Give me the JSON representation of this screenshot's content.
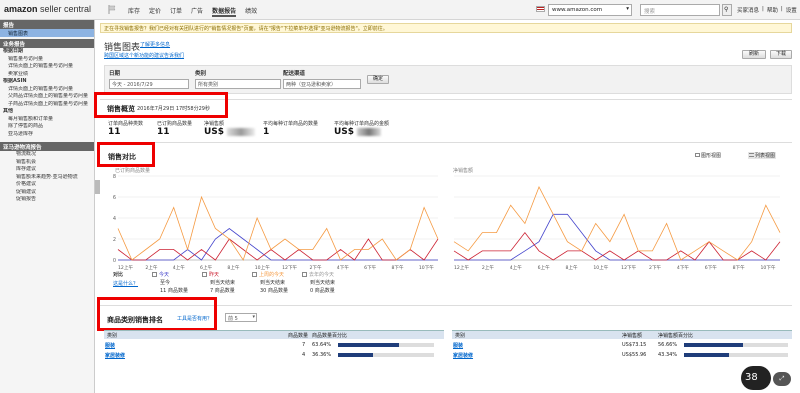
{
  "header": {
    "logo_text": "amazon",
    "logo_suffix": "seller central",
    "nav": [
      "库存",
      "定价",
      "订单",
      "广告",
      "数据报告",
      "绩效"
    ],
    "active_nav": 4,
    "site": "www.amazon.com",
    "search_placeholder": "搜索",
    "links": [
      "买家消息",
      "帮助",
      "设置"
    ]
  },
  "sidebar": {
    "head1": "报告",
    "selected": "销售图表",
    "head2": "业务报告",
    "groups": [
      {
        "title": "根据日期",
        "items": [
          "销售量与访问量",
          "详情页面上的销售量与访问量",
          "卖家业绩"
        ]
      },
      {
        "title": "根据ASIN",
        "items": [
          "详情页面上的销售量与访问量",
          "父商品详情页面上的销售量与访问量",
          "子商品详情页面上的销售量与访问量"
        ]
      },
      {
        "title": "其他",
        "items": [
          "每月销售额和订单量",
          "除了停售的商品",
          "亚马逊库存"
        ]
      }
    ],
    "head3": "亚马逊物流报告",
    "fba_items": [
      "物流概况",
      "销售机会",
      "库存建议",
      "销售额未来趋势·亚马逊物流",
      "价格建议",
      "促销建议",
      "促销报告"
    ]
  },
  "notice": "正在寻找销售报告？我们已经对有关团队进行的\"销售情况报告\"页面，请在\"报告\"下拉菜单中选择\"亚马逊物流报告\"。立即前往。",
  "page": {
    "title": "销售图表",
    "learn_more": "了解更多信息",
    "subtitle": "跨国区域这个新功能的建议告诉我们",
    "refresh": "刷新",
    "download": "下载"
  },
  "filters": {
    "date_label": "日期",
    "date_value": "今天 - 2016/7/29",
    "category_label": "类别",
    "category_value": "所有类别",
    "channel_label": "配送渠道",
    "channel_value": "两种（亚马逊和卖家）",
    "apply": "确定"
  },
  "snapshot": {
    "title": "销售概览",
    "timestamp": "2016年7月29日 17时58分29秒",
    "metrics": [
      {
        "label": "订单商品种类数",
        "value": "11"
      },
      {
        "label": "已订购商品数量",
        "value": "11"
      },
      {
        "label": "净销售额",
        "value": "US$"
      },
      {
        "label": "平均每种订单商品的数量",
        "value": "1"
      },
      {
        "label": "平均每种订单商品的金额",
        "value": "US$"
      }
    ]
  },
  "compare": {
    "title": "销售对比",
    "view_graph": "图形视图",
    "view_table": "列表视图",
    "left_title": "已订购商品数量",
    "right_title": "净销售额",
    "left_ylabels": [
      "8",
      "6",
      "4",
      "2",
      "0"
    ],
    "xlabels": [
      "12上午",
      "2上午",
      "4上午",
      "6上午",
      "8上午",
      "10上午",
      "12下午",
      "2下午",
      "4下午",
      "6下午",
      "8下午",
      "10下午"
    ],
    "legend_label": "对比",
    "legend_link": "这是什么？",
    "series": [
      {
        "name": "今天",
        "color": "#4444cc",
        "sub1": "至今",
        "sub2": "11 商品数量"
      },
      {
        "name": "昨天",
        "color": "#cc2233",
        "sub1": "到当天结束",
        "sub2": "7 商品数量"
      },
      {
        "name": "上周的今天",
        "color": "#f59a42",
        "sub1": "到当天结束",
        "sub2": "30 商品数量"
      },
      {
        "name": "去年的今天",
        "color": "#999999",
        "sub1": "到当天结束",
        "sub2": "0 商品数量"
      }
    ]
  },
  "chart_data": [
    {
      "type": "line",
      "title": "已订购商品数量",
      "ylim": [
        0,
        8
      ],
      "x": [
        "12上午",
        "2上午",
        "4上午",
        "6上午",
        "8上午",
        "10上午",
        "12下午",
        "2下午",
        "4下午",
        "6下午",
        "8下午",
        "10下午"
      ],
      "series": [
        {
          "name": "今天",
          "values": [
            0,
            0,
            0,
            0,
            0,
            1,
            0,
            2,
            3,
            2,
            1,
            0,
            0,
            0,
            0,
            0,
            0,
            0,
            0,
            0,
            0,
            0,
            0,
            0
          ]
        },
        {
          "name": "昨天",
          "values": [
            1,
            0,
            0,
            1,
            1,
            0,
            1,
            0,
            2,
            1,
            0,
            1,
            0,
            1,
            0,
            0,
            1,
            0,
            2,
            0,
            0,
            1,
            0,
            2
          ]
        },
        {
          "name": "上周的今天",
          "values": [
            3,
            0,
            1,
            2,
            5,
            1,
            6,
            3,
            2,
            0,
            4,
            1,
            2,
            1,
            1,
            3,
            0,
            1,
            1,
            2,
            0,
            1,
            5,
            2
          ]
        }
      ]
    },
    {
      "type": "line",
      "title": "净销售额",
      "x": [
        "12上午",
        "2上午",
        "4上午",
        "6上午",
        "8上午",
        "10上午",
        "12下午",
        "2下午",
        "4下午",
        "6下午",
        "8下午",
        "10下午"
      ],
      "series": [
        {
          "name": "今天",
          "values": [
            0,
            0,
            0,
            0,
            0,
            1,
            2,
            5,
            5,
            3,
            1,
            0,
            0,
            0,
            0,
            0,
            0,
            0,
            0,
            0,
            0,
            0,
            0,
            0
          ]
        },
        {
          "name": "昨天",
          "values": [
            1,
            0,
            1,
            1,
            1,
            3,
            1,
            0,
            1,
            1,
            0,
            1,
            0,
            1,
            0,
            0,
            1,
            0,
            2,
            0,
            0,
            1,
            0,
            2
          ]
        },
        {
          "name": "上周的今天",
          "values": [
            2,
            1,
            3,
            3,
            6,
            4,
            8,
            5,
            2,
            1,
            4,
            2,
            5,
            1,
            1,
            4,
            0,
            1,
            2,
            1,
            0,
            2,
            6,
            3
          ]
        }
      ]
    }
  ],
  "category": {
    "title": "商品类别销售排名",
    "helper": "工具是否有用？",
    "top": "前 5",
    "left_headers": [
      "类别",
      "商品数量",
      "商品数量百分比"
    ],
    "right_headers": [
      "类别",
      "净销售额",
      "净销售额百分比"
    ],
    "left_rows": [
      {
        "name": "服装",
        "count": "7",
        "pct": "63.64%",
        "frac": 0.6364
      },
      {
        "name": "家居装修",
        "count": "4",
        "pct": "36.36%",
        "frac": 0.3636
      }
    ],
    "right_rows": [
      {
        "name": "服装",
        "amount": "US$73.15",
        "pct": "56.66%",
        "frac": 0.5666
      },
      {
        "name": "家居装修",
        "amount": "US$55.96",
        "pct": "43.34%",
        "frac": 0.4334
      }
    ]
  },
  "timer": "38"
}
